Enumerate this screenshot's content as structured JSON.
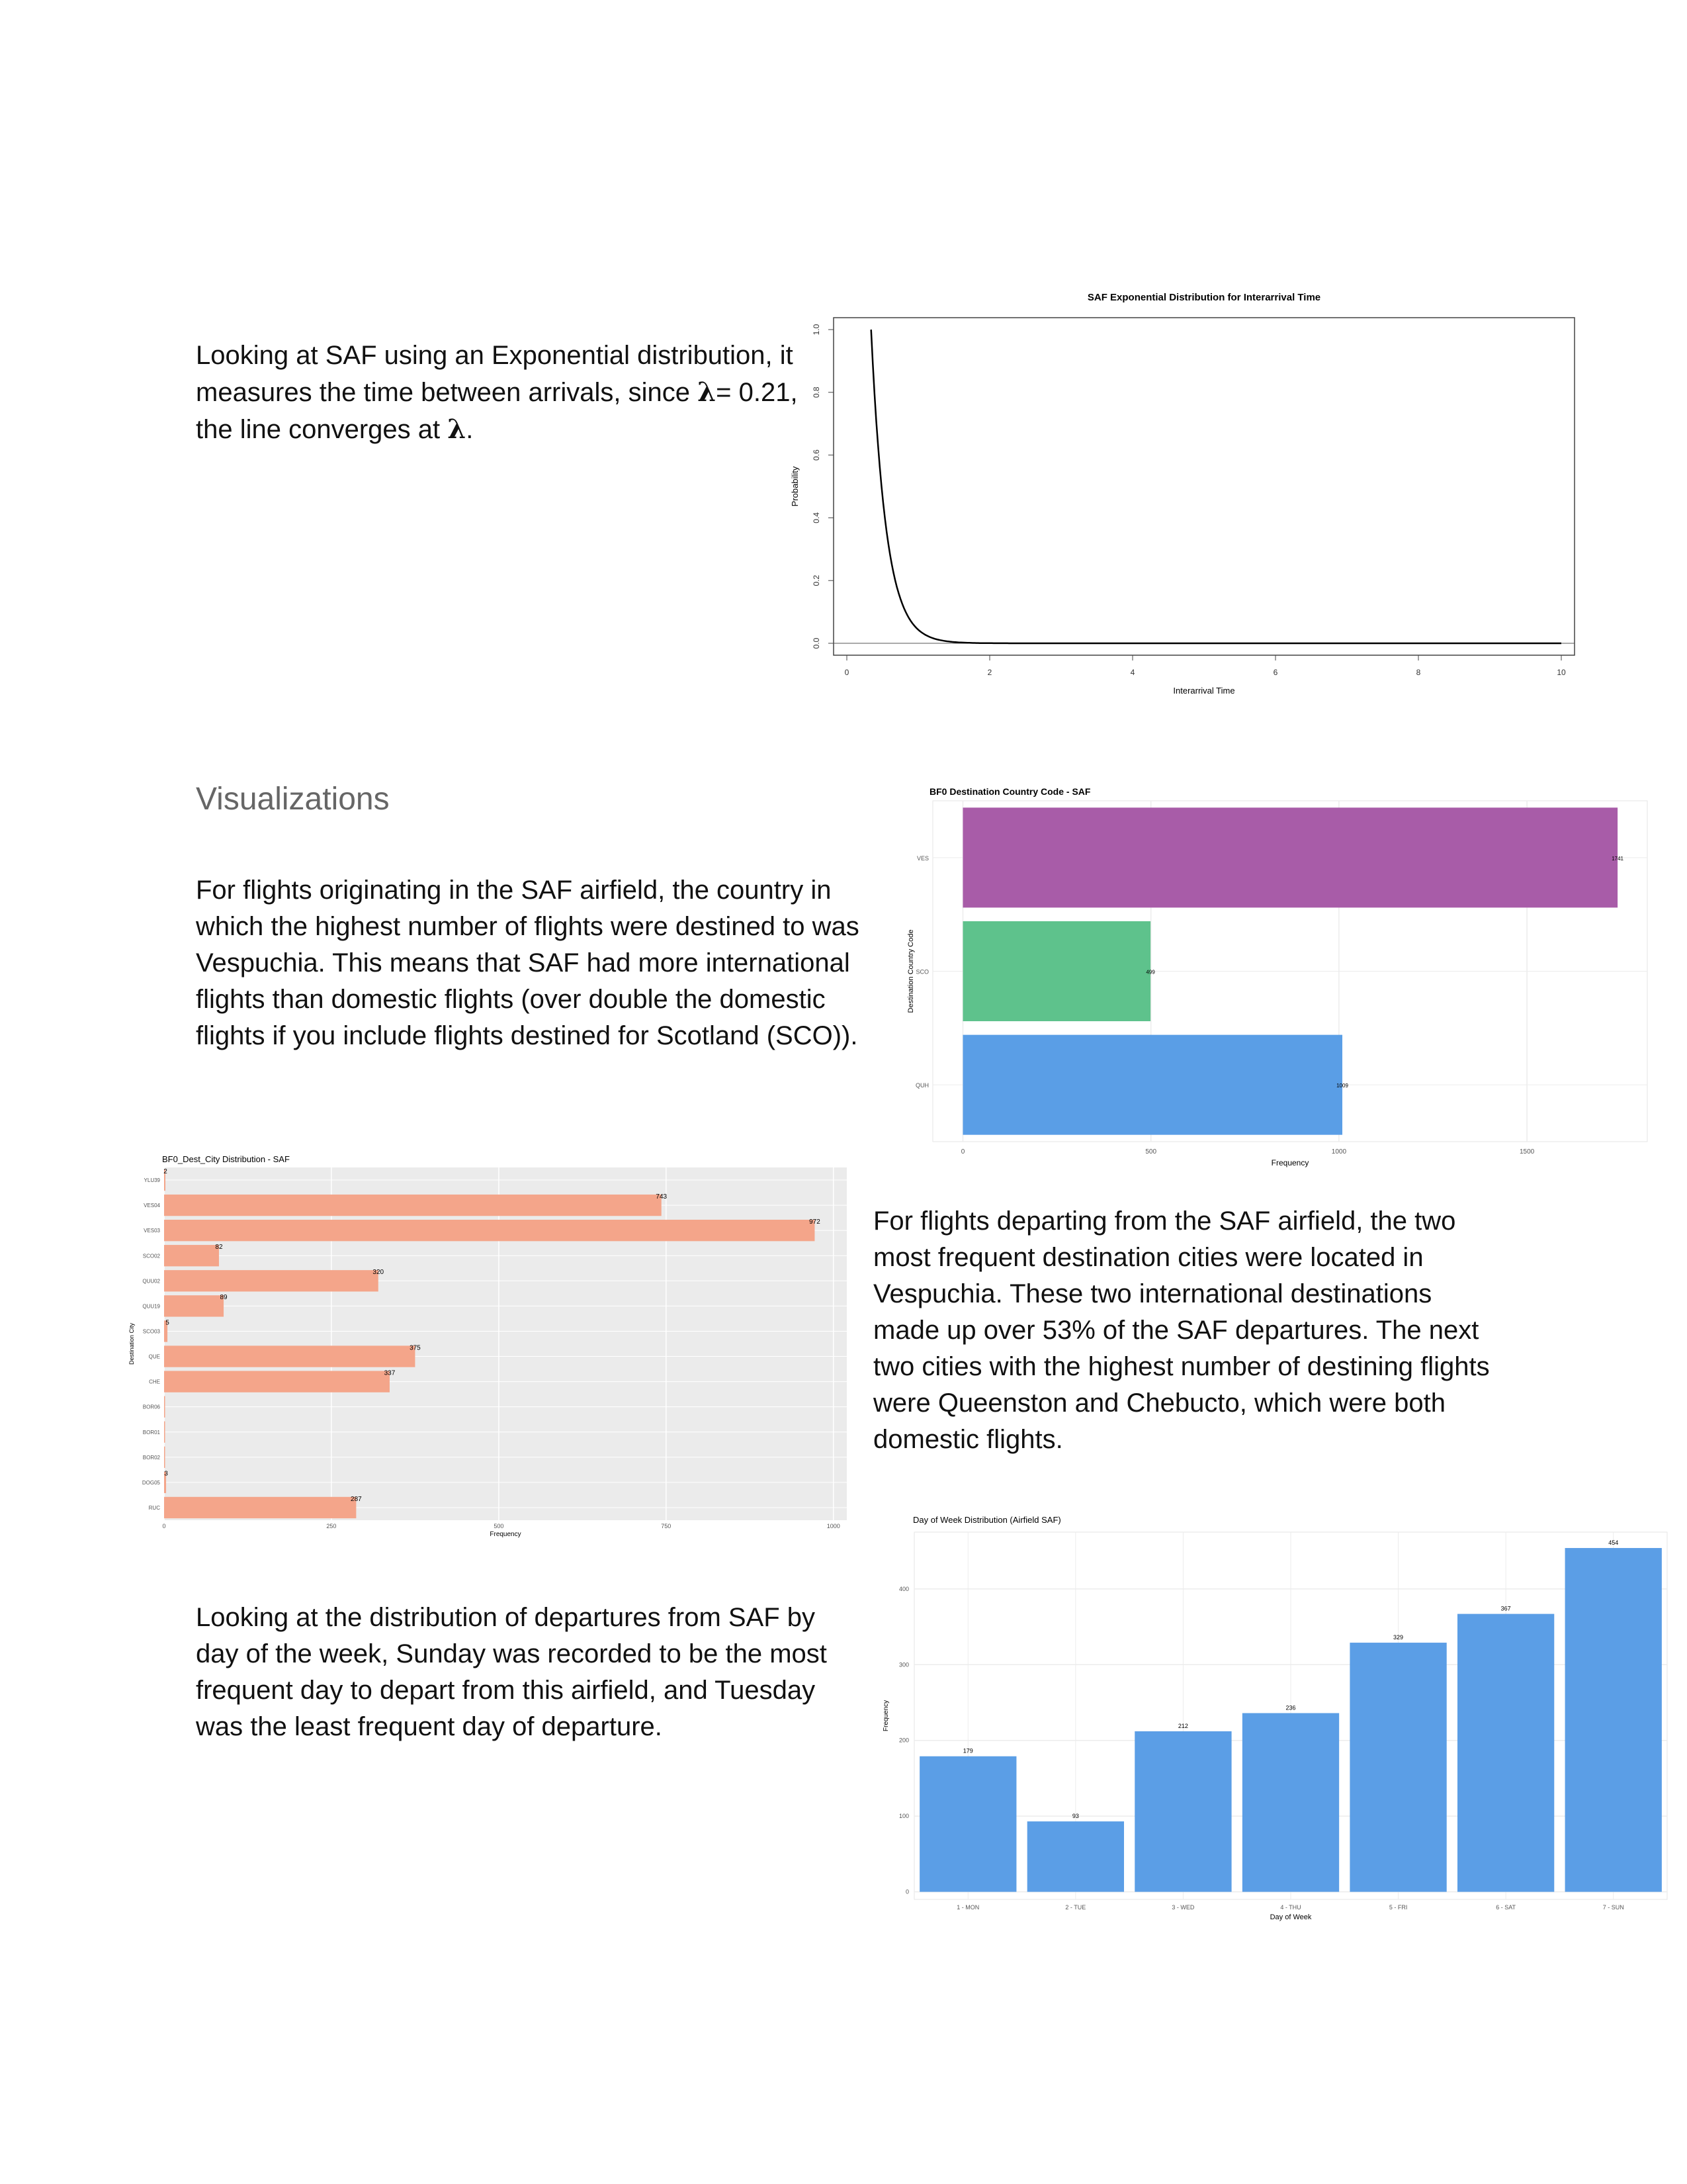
{
  "text": {
    "intro_part1": "Looking at SAF using an Exponential distribution, it measures the time between arrivals, since ",
    "lambda": "λ",
    "intro_part2": "= 0.21, the line converges at ",
    "intro_part3": ".",
    "heading": "Visualizations",
    "country_paragraph": "For flights originating in the SAF airfield, the country in which the highest number of flights were destined to was Vespuchia. This means that SAF had more international flights than domestic flights (over double the domestic flights if you include flights destined for Scotland (SCO)).",
    "city_paragraph": "For flights departing from the SAF airfield, the two most frequent destination cities were located in Vespuchia. These two international destinations made up over 53% of the SAF departures. The next two cities with the highest number of destining flights were Queenston and Chebucto, which were both domestic flights.",
    "dow_paragraph": "Looking at the distribution of departures from SAF by day of the week, Sunday was recorded to be the most frequent day to depart from this airfield, and Tuesday was the least frequent day of departure."
  },
  "chart_data": [
    {
      "type": "line",
      "title": "SAF Exponential Distribution for Interarrival Time",
      "xlabel": "Interarrival Time",
      "ylabel": "Probability",
      "xlim": [
        0,
        10
      ],
      "ylim": [
        0,
        1.0
      ],
      "xticks": [
        0,
        2,
        4,
        6,
        8,
        10
      ],
      "yticks": [
        0.0,
        0.2,
        0.4,
        0.6,
        0.8,
        1.0
      ],
      "rate": 4.76,
      "x_from": 0.34,
      "x_to": 10,
      "color": "#000000"
    },
    {
      "type": "bar",
      "orientation": "horizontal",
      "title": "BF0 Destination Country Code - SAF",
      "xlabel": "Frequency",
      "ylabel": "Destination Country Code",
      "categories": [
        "VES",
        "SCO",
        "QUH"
      ],
      "values": [
        1741,
        499,
        1009
      ],
      "value_labels": [
        "1741",
        "499",
        "1009"
      ],
      "colors": [
        "#a85ca8",
        "#5ec28c",
        "#5a9ee6"
      ],
      "xlim": [
        -80,
        1820
      ],
      "xticks": [
        0,
        500,
        1000,
        1500
      ],
      "grid": true
    },
    {
      "type": "bar",
      "orientation": "horizontal",
      "title": "BF0_Dest_City Distribution - SAF",
      "xlabel": "Frequency",
      "ylabel": "Destination City",
      "categories": [
        "YLU39",
        "VES04",
        "VES03",
        "SCO02",
        "QUU02",
        "QUU19",
        "SCO03",
        "QUE",
        "CHE",
        "BOR06",
        "BOR01",
        "BOR02",
        "DOG05",
        "RUC"
      ],
      "values": [
        2,
        743,
        972,
        82,
        320,
        89,
        5,
        375,
        337,
        1,
        1,
        1,
        3,
        287
      ],
      "value_labels": [
        "2",
        "743",
        "972",
        "82",
        "320",
        "89",
        "5",
        "375",
        "337",
        "",
        "",
        "",
        "3",
        "287"
      ],
      "color": "#f4a58a",
      "xlim": [
        0,
        1020
      ],
      "xticks": [
        0,
        250,
        500,
        750,
        1000
      ],
      "background": "#ebebeb",
      "grid": true
    },
    {
      "type": "bar",
      "title": "Day of Week Distribution (Airfield SAF)",
      "xlabel": "Day of Week",
      "ylabel": "Frequency",
      "categories": [
        "1 - MON",
        "2 - TUE",
        "3 - WED",
        "4 - THU",
        "5 - FRI",
        "6 - SAT",
        "7 - SUN"
      ],
      "values": [
        179,
        93,
        212,
        236,
        329,
        367,
        454
      ],
      "value_labels": [
        "179",
        "93",
        "212",
        "236",
        "329",
        "367",
        "454"
      ],
      "color": "#5b9ee6",
      "ylim": [
        -10,
        475
      ],
      "yticks": [
        0,
        100,
        200,
        300,
        400
      ],
      "grid": true
    }
  ]
}
